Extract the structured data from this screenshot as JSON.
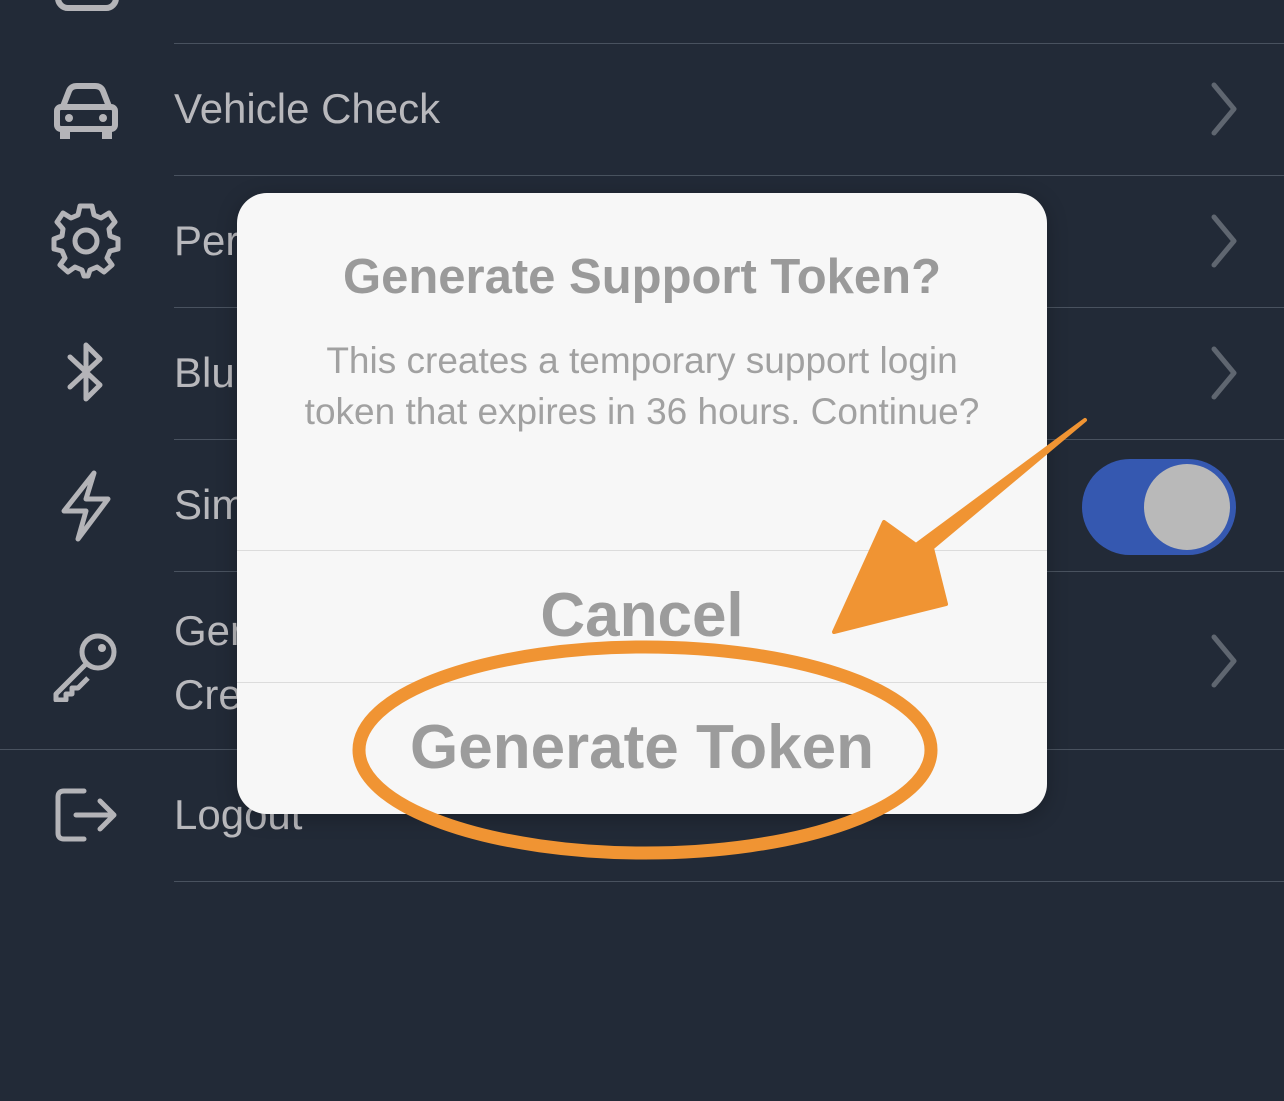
{
  "menu": {
    "items": [
      {
        "label": "Vehicle Check",
        "icon": "car-icon"
      },
      {
        "label": "Per",
        "icon": "gear-icon"
      },
      {
        "label": "Blu",
        "icon": "bluetooth-icon"
      },
      {
        "label": "Sim",
        "icon": "lightning-icon",
        "toggle_on": true
      },
      {
        "label_line1": "Ger",
        "label_line2": "Cre",
        "icon": "key-icon"
      },
      {
        "label": "Logout",
        "icon": "logout-icon"
      }
    ]
  },
  "dialog": {
    "title": "Generate Support Token?",
    "message": "This creates a temporary support login token that expires in 36 hours. Continue?",
    "cancel_label": "Cancel",
    "confirm_label": "Generate Token"
  },
  "colors": {
    "background": "#222a37",
    "toggle_on": "#3558b0",
    "annotation": "#f09433"
  }
}
